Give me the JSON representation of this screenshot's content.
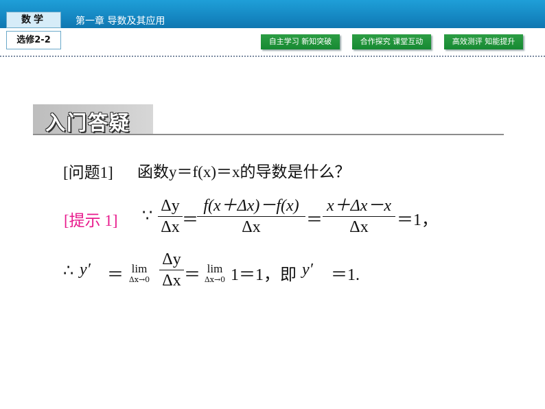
{
  "header": {
    "subject": "数学",
    "elective": "选修2-2",
    "chapter": "第一章    导数及其应用",
    "nav": [
      "自主学习 新知突破",
      "合作探究 课堂互动",
      "高效测评 知能提升"
    ]
  },
  "section": {
    "title": "入门答疑"
  },
  "question": {
    "label": "[问题1]",
    "text": "函数y＝f(x)＝x的导数是什么？"
  },
  "hint": {
    "label": "[提示 1]",
    "because": "∵",
    "f1_num": "Δy",
    "f1_den": "Δx",
    "eq": "＝",
    "f2_num": "f(x＋Δx)－f(x)",
    "f2_den": "Δx",
    "f3_num": "x＋Δx－x",
    "f3_den": "Δx",
    "result": "＝1，"
  },
  "conclusion": {
    "therefore": "∴",
    "y_prime": "y′",
    "eq": "＝",
    "lim_word": "lim",
    "lim_sub": "Δx→0",
    "frac_num": "Δy",
    "frac_den": "Δx",
    "mid": "＝",
    "lim2_word": "lim",
    "lim2_sub": "Δx→0",
    "tail": "1＝1，即",
    "y_prime2": "y′",
    "end": "＝1."
  }
}
